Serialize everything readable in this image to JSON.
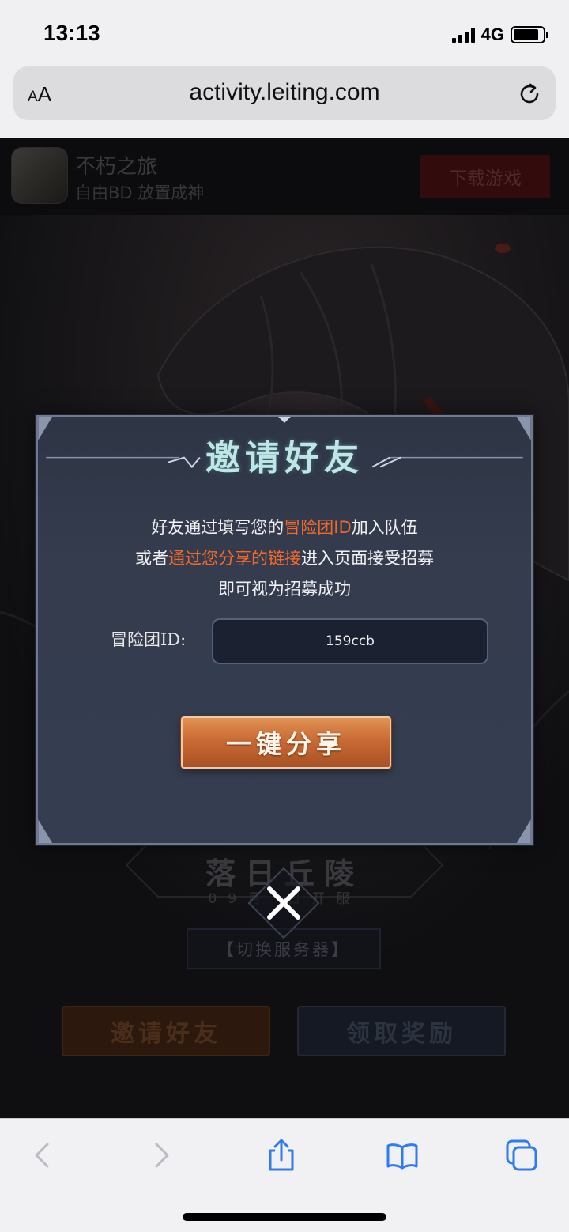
{
  "status_bar": {
    "time": "13:13",
    "network": "4G",
    "battery_level": 0.85
  },
  "browser": {
    "text_size_label": "AA",
    "url": "activity.leiting.com"
  },
  "app_banner": {
    "name": "不朽之旅",
    "slogan": "自由BD 放置成神",
    "download_label": "下载游戏"
  },
  "background_page": {
    "server_name": "落日丘陵",
    "server_date": "09月 日开服",
    "switch_server_label": "【切换服务器】",
    "invite_button_label": "邀请好友",
    "claim_button_label": "领取奖励"
  },
  "modal": {
    "title": "邀请好友",
    "line1_prefix": "好友通过填写您的",
    "line1_highlight": "冒险团ID",
    "line1_suffix": "加入队伍",
    "line2_prefix": "或者",
    "line2_highlight": "通过您分享的链接",
    "line2_suffix": "进入页面接受招募",
    "line3": "即可视为招募成功",
    "id_label": "冒险团ID:",
    "id_value": "159ccb",
    "share_button_label": "一键分享"
  },
  "colors": {
    "highlight": "#ef6a2c",
    "title": "#bfe6e4",
    "modal_bg": "#343c4e"
  },
  "toolbar_icons": [
    "back-icon",
    "forward-icon",
    "share-icon",
    "bookmarks-icon",
    "tabs-icon"
  ]
}
